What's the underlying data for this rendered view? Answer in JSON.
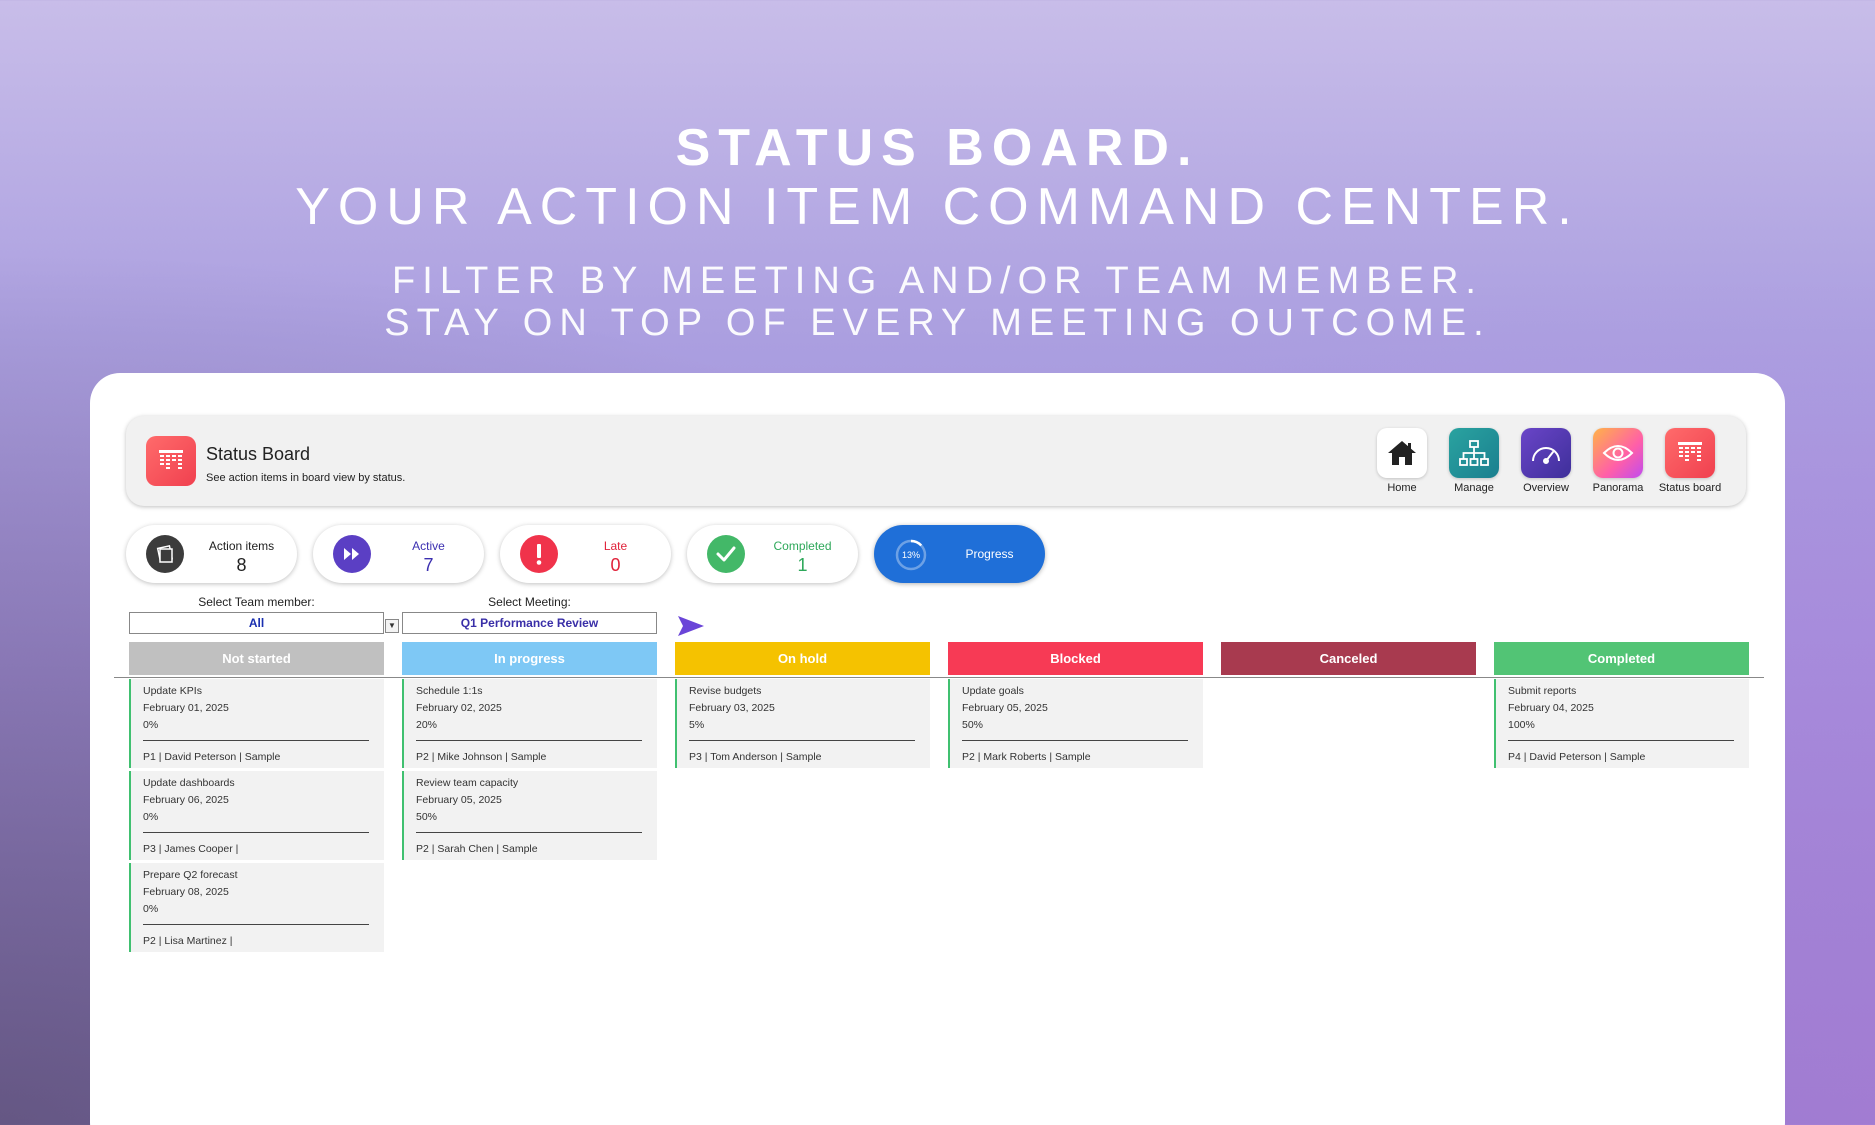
{
  "hero": {
    "title_bold": "STATUS BOARD.",
    "title_light": "YOUR ACTION ITEM COMMAND CENTER.",
    "sub_line1": "FILTER BY MEETING AND/OR TEAM MEMBER.",
    "sub_line2": "STAY ON TOP OF EVERY MEETING OUTCOME."
  },
  "header": {
    "title": "Status Board",
    "subtitle": "See action items in board view by status.",
    "icon": "status-board-icon"
  },
  "nav": [
    {
      "label": "Home",
      "icon": "home-icon",
      "color": "#ffffff"
    },
    {
      "label": "Manage",
      "icon": "org-chart-icon",
      "color": "#1e9c9a"
    },
    {
      "label": "Overview",
      "icon": "gauge-icon",
      "color": "#5b3fb0"
    },
    {
      "label": "Panorama",
      "icon": "eye-icon",
      "color": "#ff7ab0"
    },
    {
      "label": "Status board",
      "icon": "status-board-icon",
      "color": "#f0404f"
    }
  ],
  "kpis": {
    "action_items": {
      "label": "Action items",
      "value": "8",
      "color": "#222222"
    },
    "active": {
      "label": "Active",
      "value": "7",
      "color": "#3b2fb0"
    },
    "late": {
      "label": "Late",
      "value": "0",
      "color": "#e0223a"
    },
    "completed": {
      "label": "Completed",
      "value": "1",
      "color": "#2ea85a"
    },
    "progress": {
      "label": "Progress",
      "percent_text": "13%",
      "fraction": 0.13
    }
  },
  "filters": {
    "team_label": "Select Team member:",
    "team_value": "All",
    "meeting_label": "Select Meeting:",
    "meeting_value": "Q1 Performance Review"
  },
  "columns": [
    {
      "label": "Not started",
      "color": "#c0c0c0"
    },
    {
      "label": "In progress",
      "color": "#7ec8f5"
    },
    {
      "label": "On hold",
      "color": "#f5c200"
    },
    {
      "label": "Blocked",
      "color": "#f73a55"
    },
    {
      "label": "Canceled",
      "color": "#a83a4f"
    },
    {
      "label": "Completed",
      "color": "#52c475"
    }
  ],
  "cards": {
    "not_started": [
      {
        "name": "Update KPIs",
        "date": "February 01, 2025",
        "percent": "0%",
        "meta": "P1 | David Peterson | Sample"
      },
      {
        "name": "Update dashboards",
        "date": "February 06, 2025",
        "percent": "0%",
        "meta": "P3 | James Cooper |"
      },
      {
        "name": "Prepare Q2 forecast",
        "date": "February 08, 2025",
        "percent": "0%",
        "meta": "P2 | Lisa Martinez |"
      }
    ],
    "in_progress": [
      {
        "name": "Schedule 1:1s",
        "date": "February 02, 2025",
        "percent": "20%",
        "meta": "P2 | Mike Johnson | Sample"
      },
      {
        "name": "Review team capacity",
        "date": "February 05, 2025",
        "percent": "50%",
        "meta": "P2 | Sarah Chen | Sample"
      }
    ],
    "on_hold": [
      {
        "name": "Revise budgets",
        "date": "February 03, 2025",
        "percent": "5%",
        "meta": "P3 | Tom Anderson | Sample"
      }
    ],
    "blocked": [
      {
        "name": "Update goals",
        "date": "February 05, 2025",
        "percent": "50%",
        "meta": "P2 | Mark Roberts | Sample"
      }
    ],
    "canceled": [],
    "completed": [
      {
        "name": "Submit reports",
        "date": "February 04, 2025",
        "percent": "100%",
        "meta": "P4 | David Peterson | Sample"
      }
    ]
  }
}
